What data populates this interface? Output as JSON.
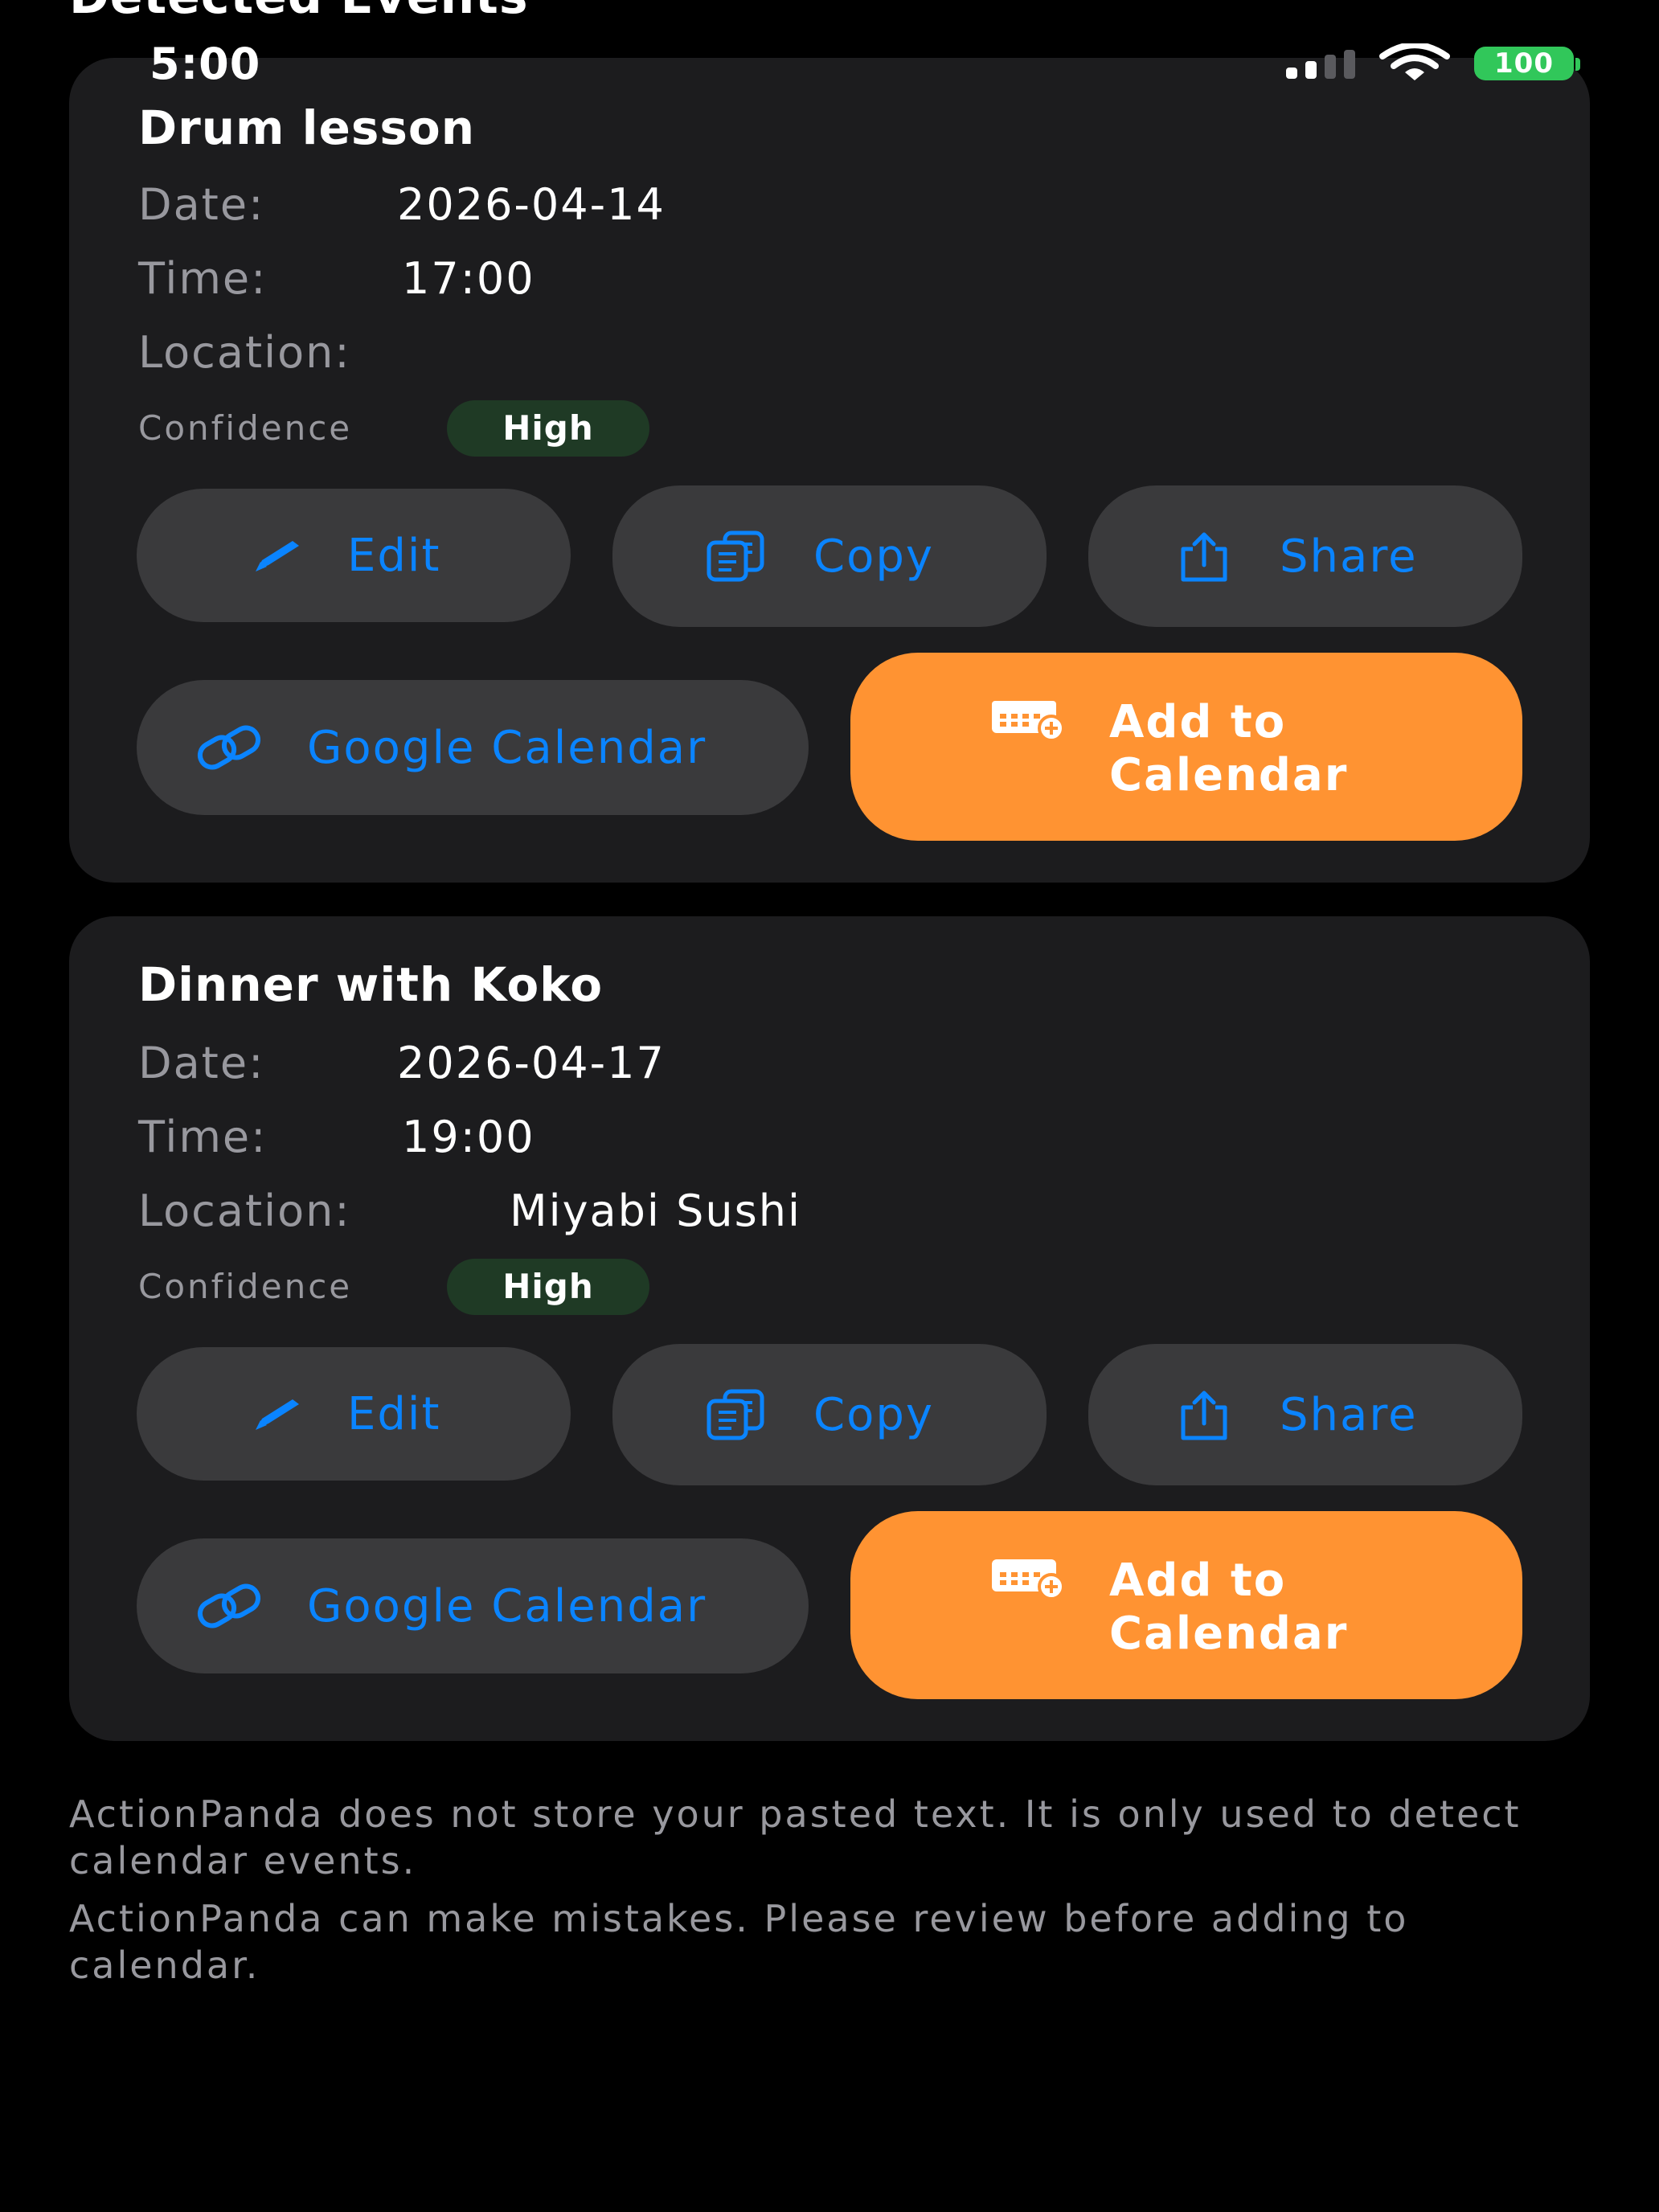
{
  "section_title": "Detected Events",
  "status_bar": {
    "time": "5:00",
    "battery": "100"
  },
  "events": [
    {
      "title": "Drum lesson",
      "date_label": "Date:",
      "date": "2026-04-14",
      "time_label": "Time:",
      "time": "17:00",
      "location_label": "Location:",
      "location": "",
      "confidence_label": "Confidence",
      "confidence": "High",
      "edit_label": "Edit",
      "copy_label": "Copy",
      "share_label": "Share",
      "google_label": "Google Calendar",
      "add_label": "Add to Calendar"
    },
    {
      "title": "Dinner with Koko",
      "date_label": "Date:",
      "date": "2026-04-17",
      "time_label": "Time:",
      "time": "19:00",
      "location_label": "Location:",
      "location": "Miyabi Sushi",
      "confidence_label": "Confidence",
      "confidence": "High",
      "edit_label": "Edit",
      "copy_label": "Copy",
      "share_label": "Share",
      "google_label": "Google Calendar",
      "add_label": "Add to Calendar"
    }
  ],
  "footer": {
    "privacy_note": "ActionPanda does not store your pasted text. It is only used to detect calendar events.",
    "disclaimer": "ActionPanda can make mistakes. Please review before adding to calendar."
  },
  "colors": {
    "background": "#000000",
    "card": "#1c1c1e",
    "button": "#3a3a3c",
    "accent_blue": "#0a84ff",
    "accent_orange": "#ff9332",
    "confidence_badge": "#1f3a25",
    "battery": "#31c75a"
  },
  "icons": [
    "pencil-icon",
    "copy-icon",
    "share-icon",
    "link-icon",
    "calendar-add-icon",
    "signal-icon",
    "wifi-icon",
    "battery-icon"
  ]
}
